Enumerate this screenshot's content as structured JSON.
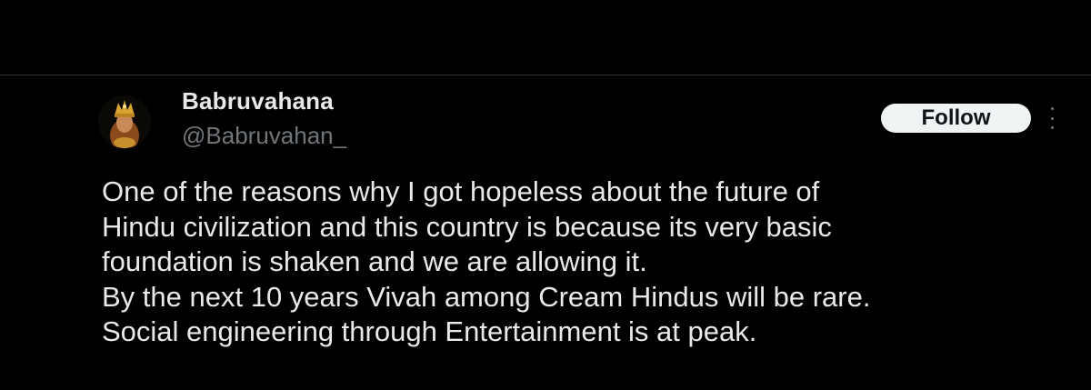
{
  "author": {
    "display_name": "Babruvahana",
    "handle": "@Babruvahan_"
  },
  "actions": {
    "follow_label": "Follow",
    "more_icon": "more-vertical-icon"
  },
  "tweet": {
    "lines": [
      "One of the reasons why I got hopeless about the future of",
      "Hindu civilization and this country is because its very basic",
      "foundation is shaken and we are allowing it.",
      "By the next 10 years Vivah among Cream Hindus will be rare.",
      "Social engineering through Entertainment is at peak."
    ]
  },
  "colors": {
    "background": "#000000",
    "text_primary": "#e7e9ea",
    "text_secondary": "#71767b",
    "follow_bg": "#eff3f4",
    "divider": "#2f3336"
  }
}
